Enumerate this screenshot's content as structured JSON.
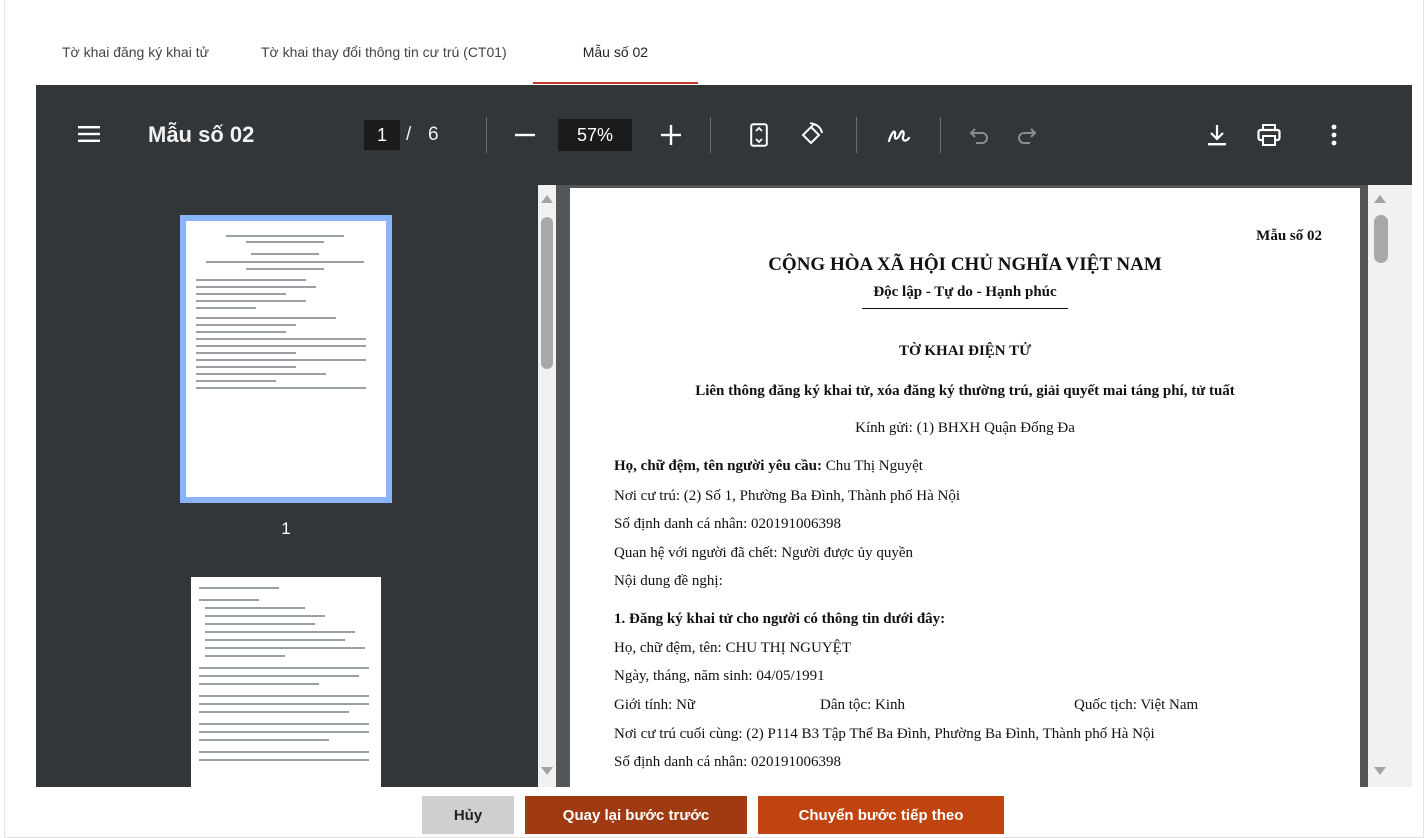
{
  "tabs": [
    {
      "label": "Tờ khai đăng ký khai tử",
      "active": false
    },
    {
      "label": "Tờ khai thay đổi thông tin cư trú (CT01)",
      "active": false
    },
    {
      "label": "Mẫu số 02",
      "active": true
    }
  ],
  "viewer": {
    "title": "Mẫu số 02",
    "current_page": "1",
    "page_separator": "/",
    "total_pages": "6",
    "zoom": "57%",
    "icons": [
      "menu-icon",
      "zoom-out-icon",
      "zoom-in-icon",
      "fit-page-icon",
      "rotate-icon",
      "annotate-icon",
      "undo-icon",
      "redo-icon",
      "download-icon",
      "print-icon",
      "more-vert-icon"
    ],
    "thumbnail_page_label": "1"
  },
  "document": {
    "form_no": "Mẫu số 02",
    "nation": "CỘNG HÒA XÃ HỘI CHỦ NGHĨA VIỆT NAM",
    "motto": "Độc lập - Tự do - Hạnh phúc",
    "title": "TỜ KHAI ĐIỆN TỬ",
    "subtitle": "Liên thông đăng ký khai tử, xóa đăng ký thường trú, giải quyết mai táng phí, tử tuất",
    "kinh_gui": "Kính gửi: (1) BHXH Quận Đống Đa",
    "requester_label": "Họ, chữ đệm, tên người yêu cầu:",
    "requester_name": " Chu Thị Nguyệt",
    "residence": "Nơi cư trú: (2) Số 1, Phường Ba Đình, Thành phố Hà Nội",
    "id_number": "Số định danh cá nhân: 020191006398",
    "relation": "Quan hệ với người đã chết: Người được ủy quyền",
    "request_content": "Nội dung đề nghị:",
    "section1": "1. Đăng ký khai tử cho người có thông tin dưới đây:",
    "deceased_name": "Họ, chữ đệm, tên: CHU THỊ NGUYỆT",
    "dob": "Ngày, tháng, năm sinh: 04/05/1991",
    "gender": "Giới tính: Nữ",
    "ethnicity": "Dân tộc: Kinh",
    "nationality": "Quốc tịch: Việt Nam",
    "last_residence": "Nơi cư trú cuối cùng: (2) P114 B3 Tập Thể Ba Đình, Phường Ba Đình, Thành phố Hà Nội",
    "deceased_id": "Số định danh cá nhân: 020191006398"
  },
  "buttons": {
    "cancel": "Hủy",
    "back": "Quay lại bước trước",
    "next": "Chuyển bước tiếp theo"
  },
  "colors": {
    "toolbar_bg": "#323639",
    "thumb_border": "#8ab4f8",
    "active_tab_underline": "#c0392b",
    "back_button": "#9f3a12",
    "next_button": "#c0440f"
  }
}
